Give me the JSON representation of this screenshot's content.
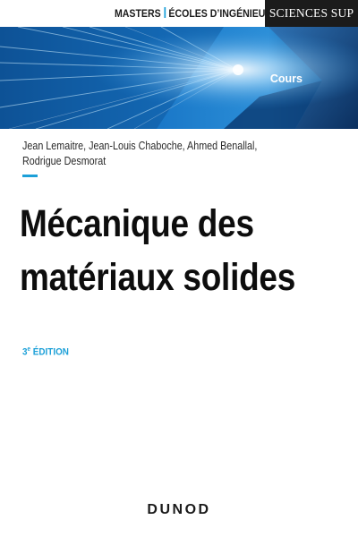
{
  "series": {
    "part1": "MASTERS",
    "part2": "ÉCOLES D’INGÉNIEURS",
    "brand": "SCIENCES SUP"
  },
  "banner": {
    "label": "Cours"
  },
  "authors": {
    "line1": "Jean Lemaitre, Jean-Louis Chaboche, Ahmed Benallal,",
    "line2": "Rodrigue Desmorat"
  },
  "title": {
    "line1": "Mécanique des",
    "line2": "matériaux solides"
  },
  "edition": {
    "number": "3",
    "sup": "e",
    "label": "ÉDITION"
  },
  "publisher": "DUNOD",
  "colors": {
    "accent": "#1ca0d8",
    "banner_dark": "#0a3a70",
    "text": "#0d0d0d"
  }
}
